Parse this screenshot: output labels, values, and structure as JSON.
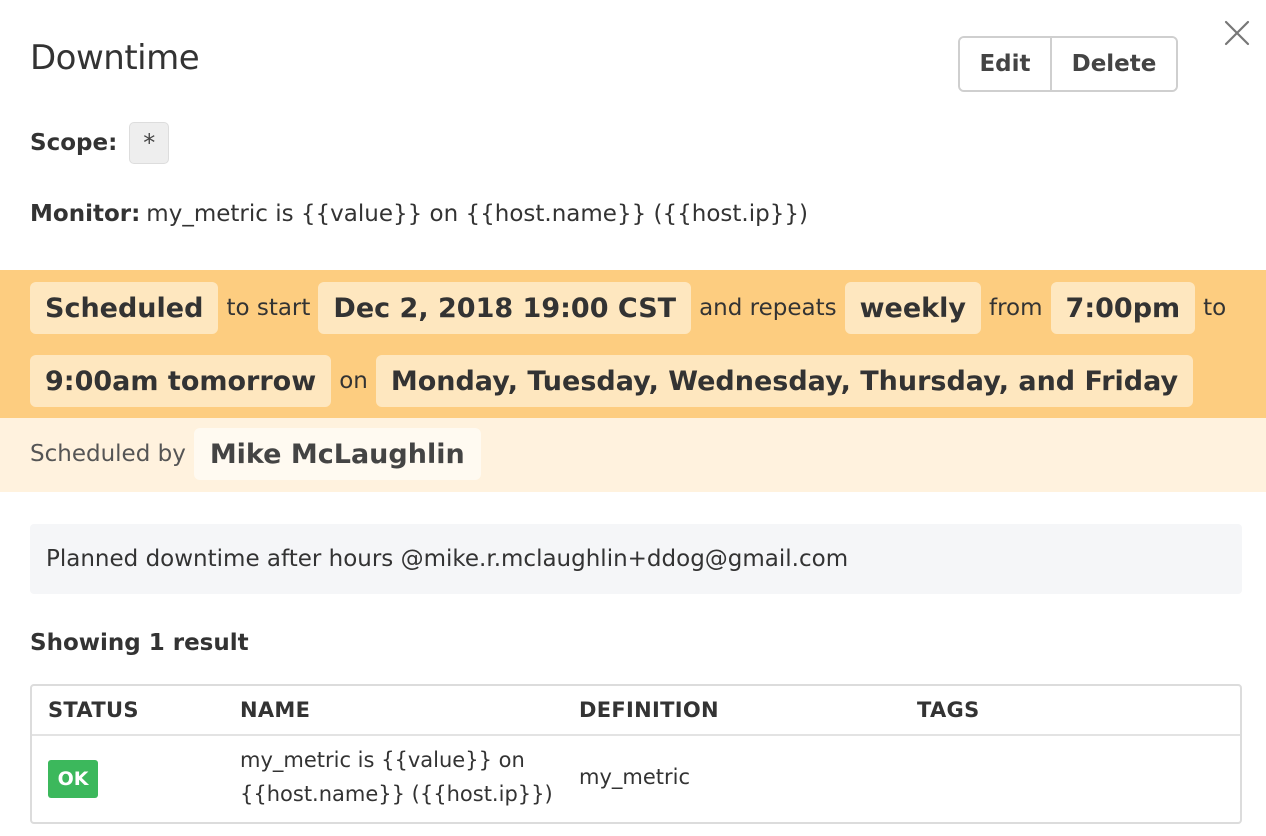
{
  "header": {
    "title": "Downtime",
    "edit_label": "Edit",
    "delete_label": "Delete"
  },
  "scope": {
    "label": "Scope:",
    "value": "*"
  },
  "monitor": {
    "label": "Monitor:",
    "value": "my_metric is {{value}} on {{host.name}} ({{host.ip}})"
  },
  "schedule": {
    "status": "Scheduled",
    "to_start": "to start",
    "start": "Dec 2, 2018 19:00 CST",
    "and_repeats": "and repeats",
    "frequency": "weekly",
    "from": "from",
    "from_time": "7:00pm",
    "to": "to",
    "to_time": "9:00am tomorrow",
    "on": "on",
    "days": "Monday, Tuesday, Wednesday, Thursday, and Friday",
    "by_label": "Scheduled by",
    "by_user": "Mike McLaughlin"
  },
  "message": "Planned downtime after hours @mike.r.mclaughlin+ddog@gmail.com",
  "results_label": "Showing 1 result",
  "table": {
    "columns": [
      "STATUS",
      "NAME",
      "DEFINITION",
      "TAGS"
    ],
    "rows": [
      {
        "status": "OK",
        "name_line1": "my_metric is {{value}} on",
        "name_line2": "{{host.name}} ({{host.ip}})",
        "definition": "my_metric",
        "tags": ""
      }
    ]
  },
  "colors": {
    "schedule_band": "#fdcd80",
    "schedule_pill": "#fee7bf",
    "scheduled_by_band": "#fff2de",
    "status_ok": "#3cb85c"
  }
}
